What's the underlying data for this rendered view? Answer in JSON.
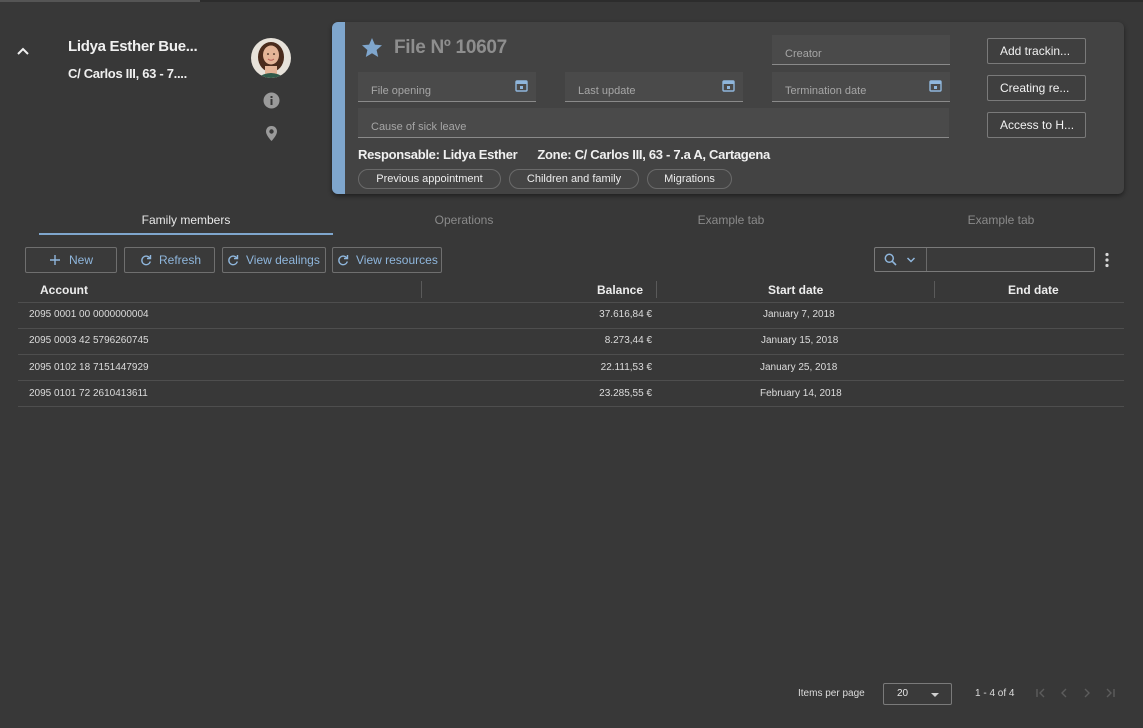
{
  "header": {
    "person_name": "Lidya Esther Bue...",
    "person_address": "C/ Carlos III, 63 - 7...."
  },
  "file_card": {
    "title": "File Nº 10607",
    "fields": {
      "creator": "Creator",
      "file_opening": "File opening",
      "last_update": "Last update",
      "termination_date": "Termination date",
      "cause": "Cause of sick leave"
    },
    "responsable": "Responsable: Lidya Esther",
    "zone": "Zone: C/ Carlos III, 63 - 7.a A, Cartagena",
    "chips": [
      "Previous appointment",
      "Children and family",
      "Migrations"
    ],
    "actions": [
      "Add trackin...",
      "Creating re...",
      "Access to H..."
    ]
  },
  "tabs": [
    "Family members",
    "Operations",
    "Example tab",
    "Example tab"
  ],
  "toolbar": {
    "new_label": "New",
    "refresh_label": "Refresh",
    "view_dealings_label": "View dealings",
    "view_resources_label": "View resources",
    "search_placeholder": ""
  },
  "table": {
    "columns": [
      "Account",
      "Balance",
      "Start date",
      "End date"
    ],
    "rows": [
      {
        "account": "2095 0001 00 0000000004",
        "balance": "37.616,84 €",
        "start": "January 7, 2018",
        "end": ""
      },
      {
        "account": "2095 0003 42 5796260745",
        "balance": "8.273,44 €",
        "start": "January 15, 2018",
        "end": ""
      },
      {
        "account": "2095 0102 18 7151447929",
        "balance": "22.111,53 €",
        "start": "January 25, 2018",
        "end": ""
      },
      {
        "account": "2095 0101 72 2610413611",
        "balance": "23.285,55 €",
        "start": "February 14, 2018",
        "end": ""
      }
    ]
  },
  "paginator": {
    "items_per_page_label": "Items per page",
    "page_size": "20",
    "range": "1 - 4 of 4"
  },
  "colors": {
    "accent": "#7fa6cd",
    "background": "#383838",
    "card": "#434343",
    "link": "#8fb6dc"
  },
  "icons": [
    "chevron-up-icon",
    "avatar-photo",
    "info-icon",
    "location-pin-icon",
    "star-icon",
    "calendar-icon",
    "plus-icon",
    "refresh-icon",
    "search-icon",
    "chevron-down-icon",
    "more-vertical-icon",
    "first-page-icon",
    "previous-page-icon",
    "next-page-icon",
    "last-page-icon"
  ]
}
